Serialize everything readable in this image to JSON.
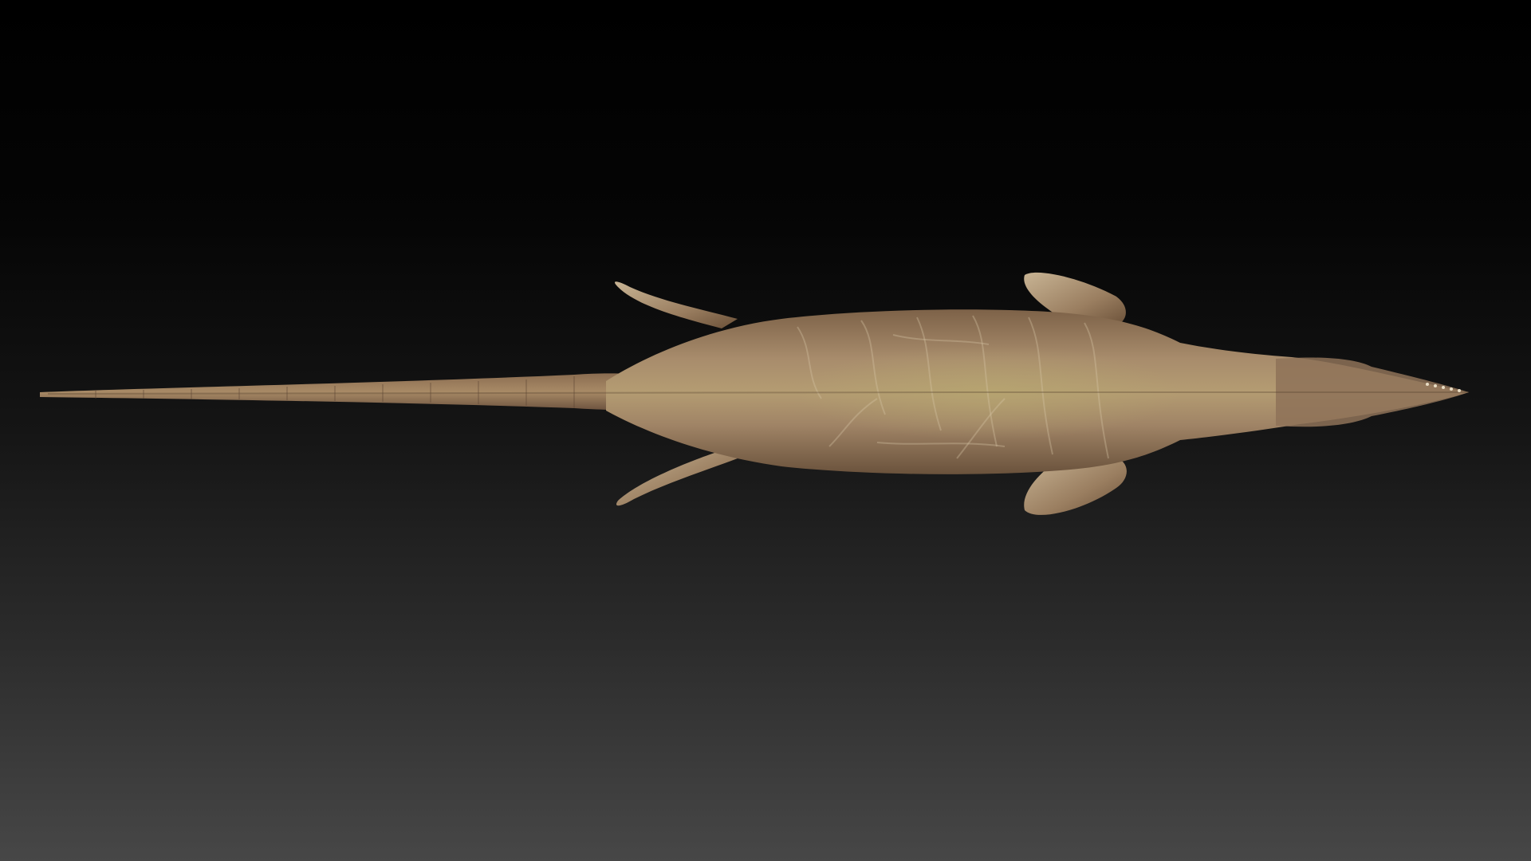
{
  "scene": {
    "subject": "creature-model-icon",
    "colors": {
      "background_top": "#000000",
      "background_bottom": "#474747",
      "skin_base": "#9a7a5a",
      "skin_light": "#b8a080",
      "skin_shadow": "#5e4630",
      "skin_belly_tint": "#a89a6e"
    }
  }
}
